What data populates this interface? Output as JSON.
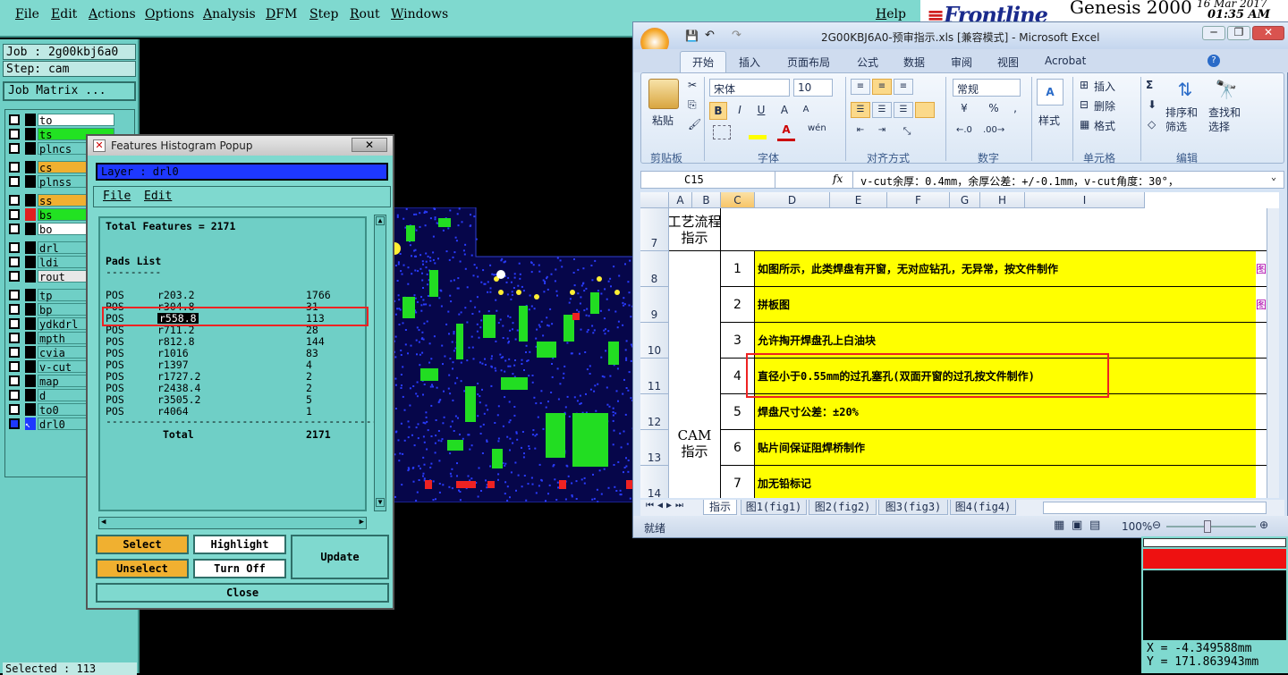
{
  "genesis": {
    "menu": [
      "File",
      "Edit",
      "Actions",
      "Options",
      "Analysis",
      "DFM",
      "Step",
      "Rout",
      "Windows"
    ],
    "help": "Help",
    "logo": "Frontline",
    "product": "Genesis 2000",
    "date": "16 Mar 2017",
    "time": "01:35 AM",
    "job": "Job : 2g00kbj6a0",
    "step": "Step: cam",
    "job_matrix": "Job Matrix ...",
    "layers": [
      {
        "name": "to",
        "color": "#000000",
        "bg": "#ffffff"
      },
      {
        "name": "ts",
        "color": "#000000",
        "bg": "#22e222"
      },
      {
        "name": "plncs",
        "color": "#000000",
        "bg": "#6fcfc6"
      },
      {
        "name": "cs",
        "color": "#000000",
        "bg": "#f0b030"
      },
      {
        "name": "plnss",
        "color": "#000000",
        "bg": "#6fcfc6"
      },
      {
        "name": "ss",
        "color": "#000000",
        "bg": "#f0b030"
      },
      {
        "name": "bs",
        "color": "#e02020",
        "bg": "#22e222"
      },
      {
        "name": "bo",
        "color": "#000000",
        "bg": "#ffffff"
      },
      {
        "name": "drl",
        "color": "#000000",
        "bg": "#6fcfc6"
      },
      {
        "name": "ldi",
        "color": "#000000",
        "bg": "#6fcfc6"
      },
      {
        "name": "rout",
        "color": "#000000",
        "bg": "#e8e8e8"
      },
      {
        "name": "tp",
        "color": "#000000",
        "bg": "#6fcfc6"
      },
      {
        "name": "bp",
        "color": "#000000",
        "bg": "#6fcfc6"
      },
      {
        "name": "ydkdrl",
        "color": "#000000",
        "bg": "#6fcfc6"
      },
      {
        "name": "mpth",
        "color": "#000000",
        "bg": "#6fcfc6"
      },
      {
        "name": "cvia",
        "color": "#000000",
        "bg": "#6fcfc6"
      },
      {
        "name": "v-cut",
        "color": "#000000",
        "bg": "#6fcfc6"
      },
      {
        "name": "map",
        "color": "#000000",
        "bg": "#6fcfc6"
      },
      {
        "name": "d",
        "color": "#000000",
        "bg": "#6fcfc6"
      },
      {
        "name": "to0",
        "color": "#000000",
        "bg": "#6fcfc6"
      },
      {
        "name": "drl0",
        "color": "#000000",
        "bg": "#6fcfc6"
      }
    ],
    "selected": "Selected : 113",
    "coords": {
      "x": "X  = -4.349588mm",
      "y": "Y  = 171.863943mm"
    }
  },
  "histogram": {
    "title": "Features Histogram Popup",
    "layer": "Layer :  drl0",
    "menu": [
      "File",
      "Edit"
    ],
    "total_features": "Total Features = 2171",
    "pads_header": "Pads List",
    "pads_rule": "---------",
    "rows": [
      {
        "type": "POS",
        "sym": "r203.2",
        "count": "1766"
      },
      {
        "type": "POS",
        "sym": "r304.8",
        "count": "31"
      },
      {
        "type": "POS",
        "sym": "r558.8",
        "count": "113"
      },
      {
        "type": "POS",
        "sym": "r711.2",
        "count": "28"
      },
      {
        "type": "POS",
        "sym": "r812.8",
        "count": "144"
      },
      {
        "type": "POS",
        "sym": "r1016",
        "count": "83"
      },
      {
        "type": "POS",
        "sym": "r1397",
        "count": "4"
      },
      {
        "type": "POS",
        "sym": "r1727.2",
        "count": "2"
      },
      {
        "type": "POS",
        "sym": "r2438.4",
        "count": "2"
      },
      {
        "type": "POS",
        "sym": "r3505.2",
        "count": "5"
      },
      {
        "type": "POS",
        "sym": "r4064",
        "count": "1"
      }
    ],
    "rule": "--------------------------------------------",
    "total_label": "Total",
    "total_value": "2171",
    "buttons": {
      "select": "Select",
      "highlight": "Highlight",
      "update": "Update",
      "unselect": "Unselect",
      "turn_off": "Turn Off",
      "close": "Close"
    }
  },
  "excel": {
    "title": "2G00KBJ6A0-预审指示.xls  [兼容模式] - Microsoft Excel",
    "tabs": [
      "开始",
      "插入",
      "页面布局",
      "公式",
      "数据",
      "审阅",
      "视图",
      "Acrobat"
    ],
    "ribbon": {
      "paste": "粘贴",
      "font_name": "宋体",
      "font_size": "10",
      "number_format": "常规",
      "styles": "样式",
      "insert": "插入",
      "delete": "删除",
      "format": "格式",
      "sort_filter": "排序和\n筛选",
      "find_select": "查找和\n选择",
      "sum": "Σ",
      "groups": [
        "剪贴板",
        "字体",
        "对齐方式",
        "数字",
        "单元格",
        "编辑"
      ]
    },
    "name_box": "C15",
    "formula": "v-cut余厚：0.4mm，余厚公差：+/-0.1mm，v-cut角度：30°，",
    "columns": [
      "A",
      "B",
      "C",
      "D",
      "E",
      "F",
      "G",
      "H",
      "I"
    ],
    "header_cell": "工艺流程\n指示",
    "cam_label": "CAM\n指示",
    "rows": [
      {
        "row": "7",
        "num": "",
        "text": ""
      },
      {
        "row": "8",
        "num": "1",
        "text": "如图所示，此类焊盘有开窗，无对应钻孔，无异常，按文件制作",
        "side": "图"
      },
      {
        "row": "9",
        "num": "2",
        "text": "拼板图",
        "side": "图"
      },
      {
        "row": "10",
        "num": "3",
        "text": "允许掏开焊盘孔上白油块",
        "side": ""
      },
      {
        "row": "11",
        "num": "4",
        "text": "直径小于0.55mm的过孔塞孔(双面开窗的过孔按文件制作)",
        "side": ""
      },
      {
        "row": "12",
        "num": "5",
        "text": "焊盘尺寸公差：±20%",
        "side": ""
      },
      {
        "row": "13",
        "num": "6",
        "text": "贴片间保证阻焊桥制作",
        "side": ""
      },
      {
        "row": "14",
        "num": "7",
        "text": "加无铅标记",
        "side": ""
      }
    ],
    "sheet_tabs": [
      "指示",
      "图1(fig1)",
      "图2(fig2)",
      "图3(fig3)",
      "图4(fig4)"
    ],
    "status": "就绪",
    "zoom": "100%"
  }
}
